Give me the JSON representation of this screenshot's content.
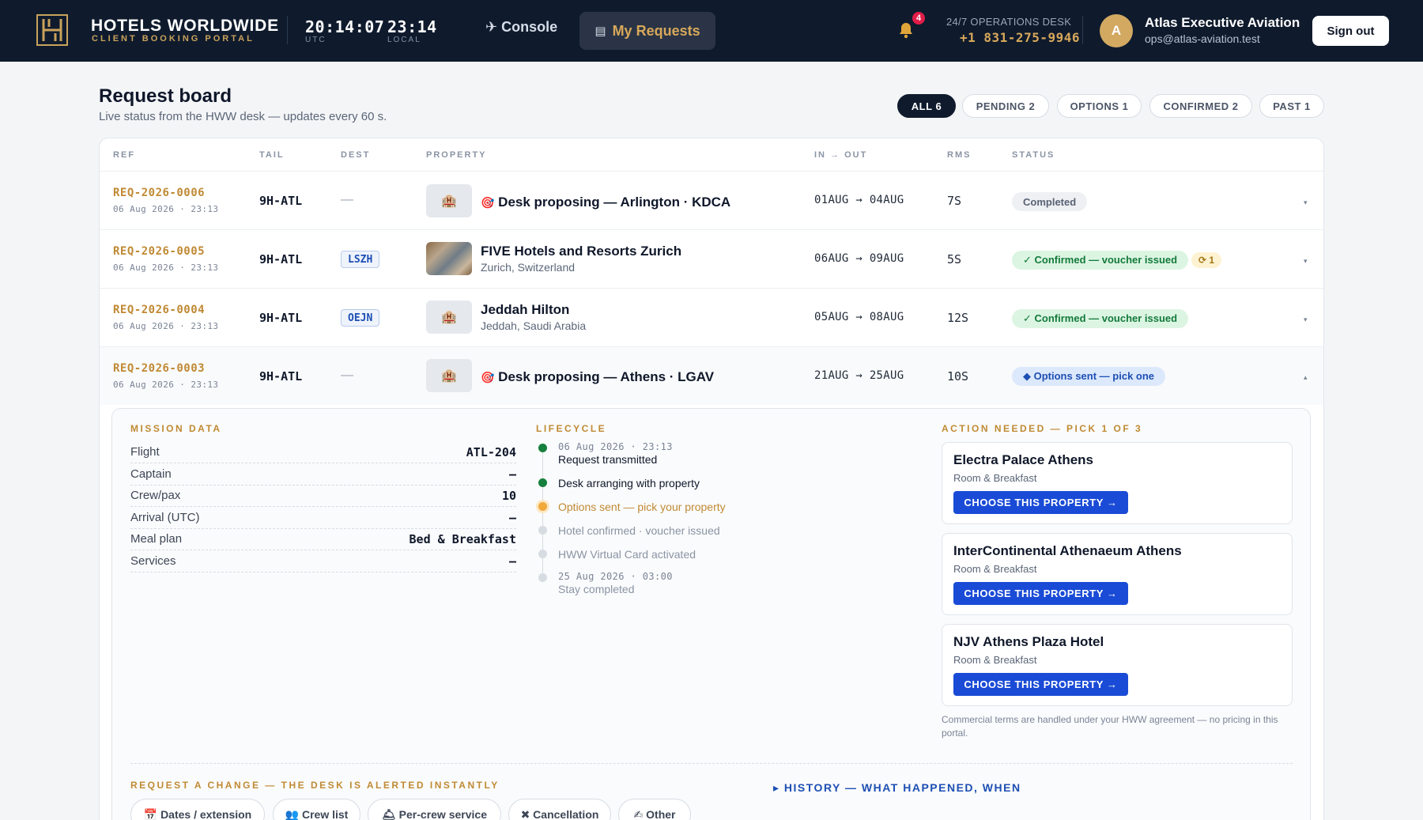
{
  "header": {
    "brand_title": "HOTELS WORLDWIDE",
    "brand_sub": "CLIENT BOOKING PORTAL",
    "logo_text": "HOTELS WORLDWIDE",
    "utc_time": "20:14:07",
    "utc_label": "UTC",
    "local_time": "23:14",
    "local_label": "LOCAL",
    "nav_console": "Console",
    "nav_requests": "My Requests",
    "notif_count": "4",
    "ops_label": "24/7 OPERATIONS DESK",
    "ops_phone": "+1 831-275-9946",
    "avatar_initial": "A",
    "account_name": "Atlas Executive Aviation",
    "account_email": "ops@atlas-aviation.test",
    "sign_out": "Sign out"
  },
  "board": {
    "title": "Request board",
    "subtitle": "Live status from the HWW desk — updates every 60 s.",
    "filters": [
      "ALL 6",
      "PENDING 2",
      "OPTIONS 1",
      "CONFIRMED 2",
      "PAST 1"
    ],
    "active_filter": "ALL 6",
    "columns": [
      "REF",
      "TAIL",
      "DEST",
      "PROPERTY",
      "IN → OUT",
      "RMS",
      "STATUS"
    ]
  },
  "rows": [
    {
      "ref": "REQ-2026-0006",
      "date": "06 Aug 2026 · 23:13",
      "tail": "9H-ATL",
      "dest": "—",
      "property": "Desk proposing — Arlington · KDCA",
      "location": "",
      "dates": "01AUG → 04AUG",
      "rms": "7S",
      "status": "Completed",
      "badge": ""
    },
    {
      "ref": "REQ-2026-0005",
      "date": "06 Aug 2026 · 23:13",
      "tail": "9H-ATL",
      "dest": "LSZH",
      "property": "FIVE Hotels and Resorts Zurich",
      "location": "Zurich, Switzerland",
      "dates": "06AUG → 09AUG",
      "rms": "5S",
      "status": "✓ Confirmed — voucher issued",
      "badge": "⟳ 1"
    },
    {
      "ref": "REQ-2026-0004",
      "date": "06 Aug 2026 · 23:13",
      "tail": "9H-ATL",
      "dest": "OEJN",
      "property": "Jeddah Hilton",
      "location": "Jeddah, Saudi Arabia",
      "dates": "05AUG → 08AUG",
      "rms": "12S",
      "status": "✓ Confirmed — voucher issued",
      "badge": ""
    },
    {
      "ref": "REQ-2026-0003",
      "date": "06 Aug 2026 · 23:13",
      "tail": "9H-ATL",
      "dest": "—",
      "property": "Desk proposing — Athens · LGAV",
      "location": "",
      "dates": "21AUG → 25AUG",
      "rms": "10S",
      "status": "◆ Options sent — pick one",
      "badge": ""
    }
  ],
  "mission": {
    "label": "MISSION DATA",
    "fields": [
      {
        "k": "Flight",
        "v": "ATL-204"
      },
      {
        "k": "Captain",
        "v": "—"
      },
      {
        "k": "Crew/pax",
        "v": "10"
      },
      {
        "k": "Arrival (UTC)",
        "v": "—"
      },
      {
        "k": "Meal plan",
        "v": "Bed & Breakfast"
      },
      {
        "k": "Services",
        "v": "—"
      }
    ]
  },
  "lifecycle": {
    "label": "LIFECYCLE",
    "steps": [
      {
        "date": "06 Aug 2026 · 23:13",
        "text": "Request transmitted",
        "state": "done"
      },
      {
        "date": "",
        "text": "Desk arranging with property",
        "state": "done"
      },
      {
        "date": "",
        "text": "Options sent — pick your property",
        "state": "current"
      },
      {
        "date": "",
        "text": "Hotel confirmed · voucher issued",
        "state": "pending"
      },
      {
        "date": "",
        "text": "HWW Virtual Card activated",
        "state": "pending"
      },
      {
        "date": "25 Aug 2026 · 03:00",
        "text": "Stay completed",
        "state": "pending"
      }
    ]
  },
  "action": {
    "label": "ACTION NEEDED — PICK 1 OF 3",
    "options": [
      {
        "name": "Electra Palace Athens",
        "meal": "Room & Breakfast",
        "button": "CHOOSE THIS PROPERTY →"
      },
      {
        "name": "InterContinental Athenaeum Athens",
        "meal": "Room & Breakfast",
        "button": "CHOOSE THIS PROPERTY →"
      },
      {
        "name": "NJV Athens Plaza Hotel",
        "meal": "Room & Breakfast",
        "button": "CHOOSE THIS PROPERTY →"
      }
    ],
    "terms": "Commercial terms are handled under your HWW agreement — no pricing in this portal."
  },
  "change": {
    "label": "REQUEST A CHANGE — THE DESK IS ALERTED INSTANTLY",
    "history_label": "▸ HISTORY — WHAT HAPPENED, WHEN",
    "chips": [
      "📅 Dates / extension",
      "👥 Crew list",
      "🛎 Per-crew service",
      "✖ Cancellation",
      "✍ Other"
    ]
  },
  "colors": {
    "navy": "#0f1b2d",
    "gold": "#c08a34",
    "blue": "#1a4bd6",
    "green": "#137a3a"
  },
  "icons": {
    "console": "plane-icon",
    "requests": "clipboard-icon",
    "bell": "bell-icon",
    "property": "hotel-icon",
    "proposing": "target-icon"
  }
}
